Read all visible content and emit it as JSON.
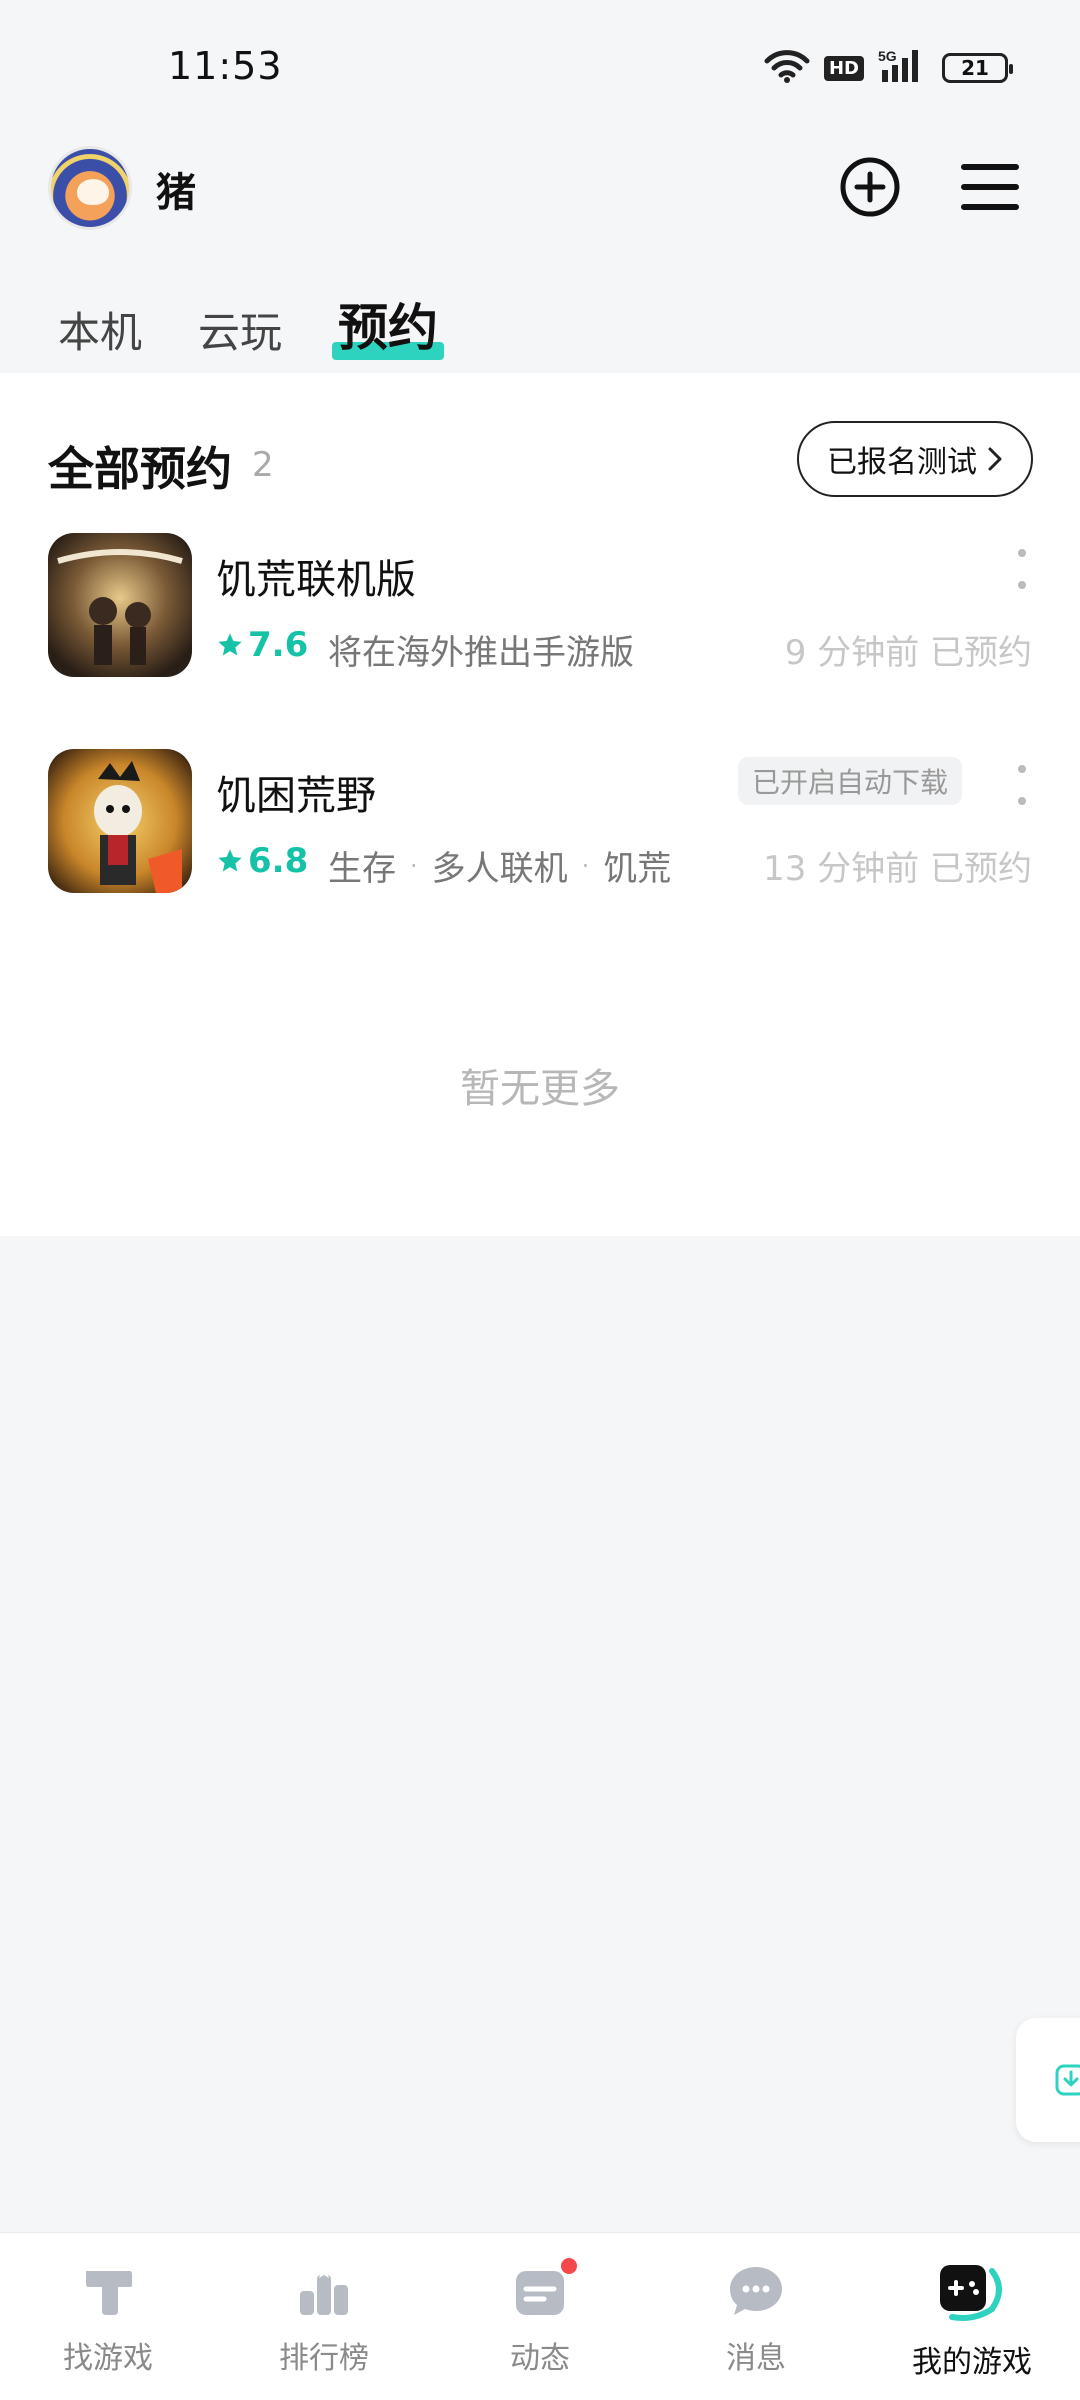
{
  "status_bar": {
    "time": "11:53",
    "battery": "21",
    "network": "5G",
    "hd": "HD"
  },
  "header": {
    "username": "猪"
  },
  "tabs": [
    {
      "label": "本机",
      "active": false
    },
    {
      "label": "云玩",
      "active": false
    },
    {
      "label": "预约",
      "active": true
    }
  ],
  "section": {
    "title": "全部预约",
    "count": "2",
    "test_button": "已报名测试"
  },
  "games": [
    {
      "name": "饥荒联机版",
      "rating": "7.6",
      "desc": [
        "将在海外推出手游版"
      ],
      "time": "9 分钟前 已预约",
      "badge": ""
    },
    {
      "name": "饥困荒野",
      "rating": "6.8",
      "desc": [
        "生存",
        "多人联机",
        "饥荒"
      ],
      "time": "13 分钟前 已预约",
      "badge": "已开启自动下载"
    }
  ],
  "no_more": "暂无更多",
  "bottom_nav": [
    {
      "label": "找游戏",
      "icon": "find-game-icon"
    },
    {
      "label": "排行榜",
      "icon": "ranking-icon"
    },
    {
      "label": "动态",
      "icon": "feed-icon"
    },
    {
      "label": "消息",
      "icon": "message-icon"
    },
    {
      "label": "我的游戏",
      "icon": "my-games-icon"
    }
  ],
  "colors": {
    "accent": "#2ed3c0",
    "rating": "#16c2a7",
    "notification": "#f5484d"
  }
}
